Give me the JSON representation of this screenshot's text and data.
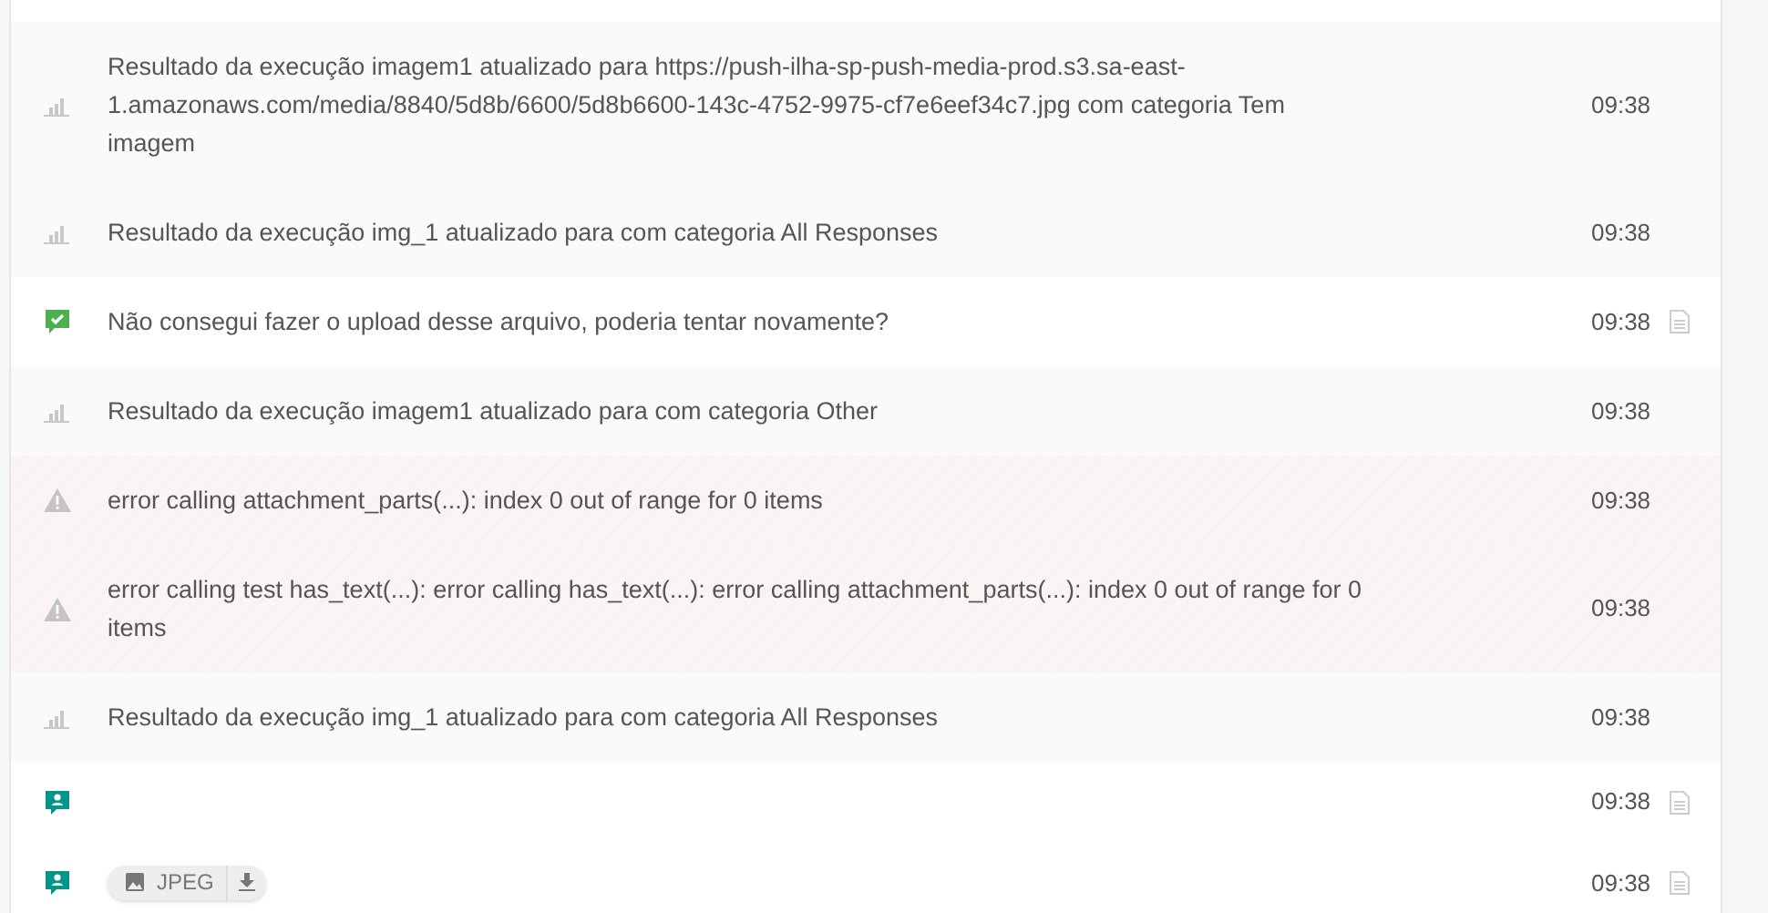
{
  "messages": [
    {
      "kind": "result",
      "text": "Resultado da execução imagem1 atualizado para https://push-ilha-sp-push-media-prod.s3.sa-east-1.amazonaws.com/media/8840/5d8b/6600/5d8b6600-143c-4752-9975-cf7e6eef34c7.jpg com categoria Tem imagem",
      "time": "09:38",
      "has_log": false
    },
    {
      "kind": "result",
      "text": "Resultado da execução img_1 atualizado para com categoria All Responses",
      "time": "09:38",
      "has_log": false
    },
    {
      "kind": "sent",
      "text": "Não consegui fazer o upload desse arquivo, poderia tentar novamente?",
      "time": "09:38",
      "has_log": true
    },
    {
      "kind": "result",
      "text": "Resultado da execução imagem1 atualizado para com categoria Other",
      "time": "09:38",
      "has_log": false
    },
    {
      "kind": "error",
      "text": "error calling attachment_parts(...): index 0 out of range for 0 items",
      "time": "09:38",
      "has_log": false
    },
    {
      "kind": "error",
      "text": "error calling test has_text(...): error calling has_text(...): error calling attachment_parts(...): index 0 out of range for 0 items",
      "time": "09:38",
      "has_log": false
    },
    {
      "kind": "result",
      "text": "Resultado da execução img_1 atualizado para com categoria All Responses",
      "time": "09:38",
      "has_log": false
    },
    {
      "kind": "received",
      "time": "09:38",
      "has_log": true
    },
    {
      "kind": "received",
      "attachment": {
        "label": "JPEG"
      },
      "time": "09:38",
      "has_log": true
    }
  ]
}
